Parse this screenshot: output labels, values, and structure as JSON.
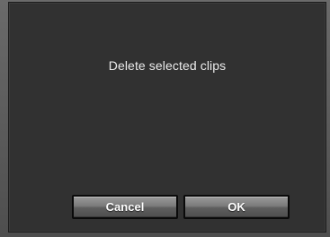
{
  "dialog": {
    "message": "Delete selected clips",
    "cancel_label": "Cancel",
    "ok_label": "OK"
  }
}
